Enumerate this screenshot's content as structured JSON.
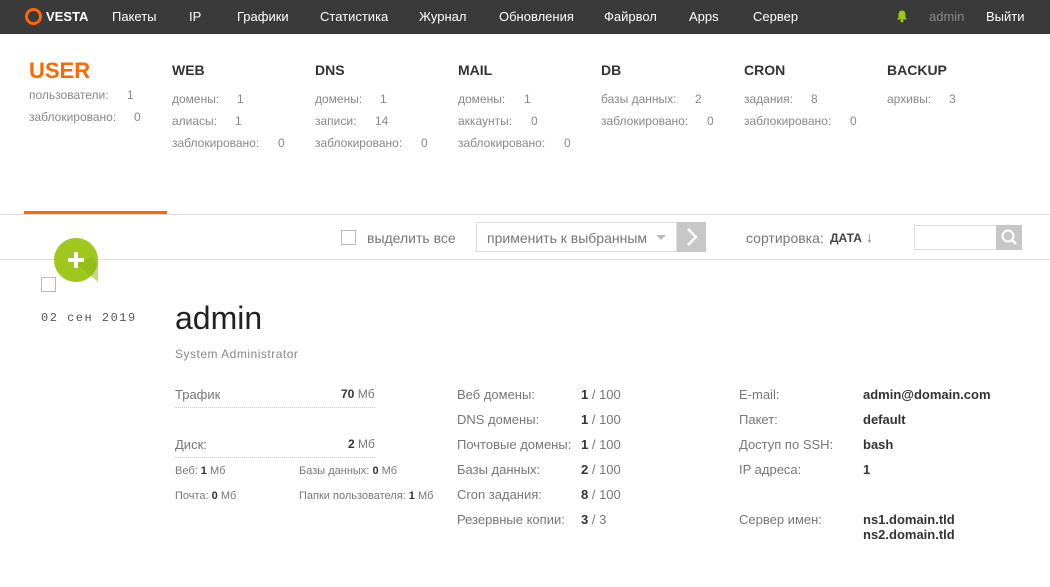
{
  "topbar": {
    "logo_text": "VESTA",
    "nav": [
      "Пакеты",
      "IP",
      "Графики",
      "Статистика",
      "Журнал",
      "Обновления",
      "Файрвол",
      "Apps",
      "Сервер"
    ],
    "user": "admin",
    "logout": "Выйти",
    "accent": "#ff6701",
    "background": "#3a3a3a"
  },
  "stats": {
    "user": {
      "title": "USER",
      "rows": [
        [
          "пользователи:",
          "1"
        ],
        [
          "заблокировано:",
          "0"
        ]
      ]
    },
    "web": {
      "title": "WEB",
      "rows": [
        [
          "домены:",
          "1"
        ],
        [
          "алиасы:",
          "1"
        ],
        [
          "заблокировано:",
          "0"
        ]
      ]
    },
    "dns": {
      "title": "DNS",
      "rows": [
        [
          "домены:",
          "1"
        ],
        [
          "записи:",
          "14"
        ],
        [
          "заблокировано:",
          "0"
        ]
      ]
    },
    "mail": {
      "title": "MAIL",
      "rows": [
        [
          "домены:",
          "1"
        ],
        [
          "аккаунты:",
          "0"
        ],
        [
          "заблокировано:",
          "0"
        ]
      ]
    },
    "db": {
      "title": "DB",
      "rows": [
        [
          "базы данных:",
          "2"
        ],
        [
          "заблокировано:",
          "0"
        ]
      ]
    },
    "cron": {
      "title": "CRON",
      "rows": [
        [
          "задания:",
          "8"
        ],
        [
          "заблокировано:",
          "0"
        ]
      ]
    },
    "backup": {
      "title": "BACKUP",
      "rows": [
        [
          "архивы:",
          "3"
        ]
      ]
    }
  },
  "toolbar": {
    "select_all": "выделить все",
    "apply_placeholder": "применить к выбранным",
    "sort_label": "сортировка:",
    "sort_value": "ДАТА",
    "sort_arrow": "↓",
    "add_button": "+"
  },
  "record": {
    "date": "02  сен  2019",
    "name": "admin",
    "role": "System Administrator",
    "traffic_label": "Трафик",
    "traffic_value": "70",
    "traffic_unit": "Мб",
    "disk_label": "Диск:",
    "disk_value": "2",
    "disk_unit": "Мб",
    "disk_web_label": "Веб:",
    "disk_web_value": "1",
    "disk_mail_label": "Почта:",
    "disk_mail_value": "0",
    "disk_db_label": "Базы данных:",
    "disk_db_value": "0",
    "disk_dirs_label": "Папки пользователя:",
    "disk_dirs_value": "1",
    "unit_mb": "Мб",
    "limits": [
      {
        "label": "Веб домены:",
        "used": "1",
        "total": "100"
      },
      {
        "label": "DNS домены:",
        "used": "1",
        "total": "100"
      },
      {
        "label": "Почтовые домены:",
        "used": "1",
        "total": "100"
      },
      {
        "label": "Базы данных:",
        "used": "2",
        "total": "100"
      },
      {
        "label": "Cron задания:",
        "used": "8",
        "total": "100"
      },
      {
        "label": "Резервные копии:",
        "used": "3",
        "total": "3"
      }
    ],
    "email_label": "E-mail:",
    "email_value": "admin@domain.com",
    "package_label": "Пакет:",
    "package_value": "default",
    "ssh_label": "Доступ по SSH:",
    "ssh_value": "bash",
    "ip_label": "IP адреса:",
    "ip_value": "1",
    "ns_label": "Сервер имен:",
    "ns1": "ns1.domain.tld",
    "ns2": "ns2.domain.tld"
  }
}
